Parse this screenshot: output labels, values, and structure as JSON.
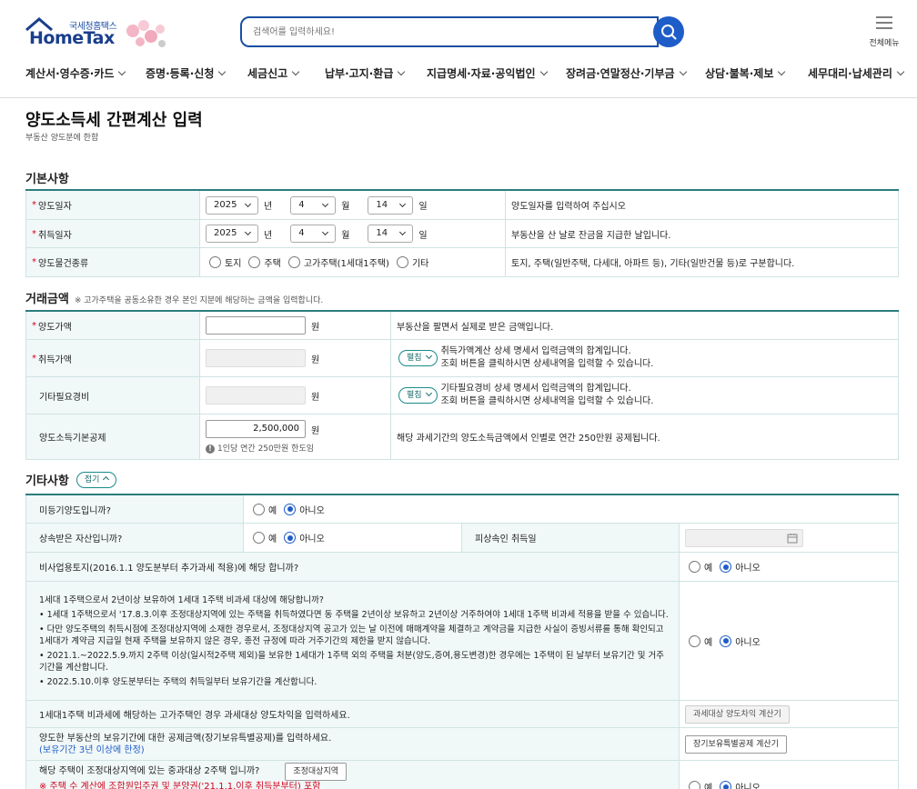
{
  "header": {
    "logo_small": "국세청홈택스",
    "logo_big": "HomeTax",
    "search_placeholder": "검색어를 입력하세요!",
    "all_menu_label": "전체메뉴"
  },
  "nav": [
    "계산서·영수증·카드",
    "증명·등록·신청",
    "세금신고",
    "납부·고지·환급",
    "지급명세·자료·공익법인",
    "장려금·연말정산·기부금",
    "상담·불복·제보",
    "세무대리·납세관리"
  ],
  "page": {
    "title": "양도소득세 간편계산 입력",
    "subtitle": "부동산 양도분에 한함"
  },
  "basic": {
    "section_title": "기본사항",
    "rows": [
      {
        "label": "양도일자",
        "year": "2025",
        "month": "4",
        "day": "14",
        "year_unit": "년",
        "month_unit": "월",
        "day_unit": "일",
        "desc": "양도일자를 입력하여 주십시오"
      },
      {
        "label": "취득일자",
        "year": "2025",
        "month": "4",
        "day": "14",
        "year_unit": "년",
        "month_unit": "월",
        "day_unit": "일",
        "desc": "부동산을 산 날로 잔금을 지급한 날입니다."
      }
    ],
    "type_row": {
      "label": "양도물건종류",
      "options": [
        "토지",
        "주택",
        "고가주택(1세대1주택)",
        "기타"
      ],
      "desc": "토지, 주택(일반주택, 다세대, 아파트 등), 기타(일반건물 등)로 구분합니다."
    }
  },
  "amount": {
    "section_title": "거래금액",
    "note": "※ 고가주택을 공동소유한 경우 본인 지분에 해당하는 금액을 입력합니다.",
    "unit": "원",
    "sale": {
      "label": "양도가액",
      "value": "",
      "desc": "부동산을 팔면서 실제로 받은 금액입니다."
    },
    "acq": {
      "label": "취득가액",
      "btn": "펼침",
      "desc1": "취득가액계산 상세 명세서 입력금액의 합계입니다.",
      "desc2": "조회 버튼을 클릭하시면 상세내역을 입력할 수 있습니다."
    },
    "exp": {
      "label": "기타필요경비",
      "btn": "펼침",
      "desc1": "기타필요경비 상세 명세서 입력금액의 합계입니다.",
      "desc2": "조회 버튼을 클릭하시면 상세내역을 입력할 수 있습니다."
    },
    "ded": {
      "label": "양도소득기본공제",
      "value": "2,500,000",
      "hint": "1인당 연간 250만원 한도임",
      "desc": "해당 과세기간의 양도소득금액에서 인별로 연간 250만원 공제됩니다."
    }
  },
  "etc": {
    "section_title": "기타사항",
    "toggle": "접기",
    "yes": "예",
    "no": "아니오",
    "q1": "미등기양도입니까?",
    "q2": "상속받은 자산입니까?",
    "q2_extra": "피상속인 취득일",
    "q3": "비사업용토지(2016.1.1 양도분부터 추가과세 적용)에 해당 합니까?",
    "q4_title": "1세대 1주택으로서 2년이상 보유하여 1세대 1주택 비과세 대상에 해당합니까?",
    "q4_notes": [
      "1세대 1주택으로서 '17.8.3.이후 조정대상지역에 있는 주택을 취득하였다면 동 주택을 2년이상 보유하고 2년이상 거주하여야 1세대 1주택 비과세 적용을 받을 수 있습니다.",
      "다만 양도주택의 취득시점에 조정대상지역에 소재한 경우로서, 조정대상지역 공고가 있는 날 이전에 매매계약을 체결하고 계약금을 지급한 사실이 증빙서류를 통해 확인되고 1세대가 계약금 지급일 현재 주택을 보유하지 않은 경우, 종전 규정에 따라 거주기간의 제한을 받지 않습니다.",
      "2021.1.~2022.5.9.까지 2주택 이상(일시적2주택 제외)을 보유한 1세대가 1주택 외의 주택을 처분(양도,증여,용도변경)한 경우에는 1주택이 된 날부터 보유기간 및 거주기간을 계산합니다.",
      "2022.5.10.이후 양도분부터는 주택의 취득일부터 보유기간을 계산합니다."
    ],
    "q5": "1세대1주택 비과세에 해당하는 고가주택인 경우 과세대상 양도차익을 입력하세요.",
    "q5_btn": "과세대상 양도차익 계산기",
    "q6": "양도한 부동산의 보유기간에 대한 공제금액(장기보유특별공제)를 입력하세요.",
    "q6_sub": "(보유기간 3년 이상에 한정)",
    "q6_btn": "장기보유특별공제 계산기",
    "q7": "해당 주택이 조정대상지역에 있는 중과대상 2주택 입니까?",
    "q7_btn": "조정대상지역",
    "q7_warn": "※ 주택 수 계산에 조합원입주권 및 분양권('21.1.1.이후 취득분부터) 포함"
  },
  "colors": {
    "accent": "#2c7d7d",
    "blue": "#1e5cc8",
    "red": "#d0021b",
    "th_bg": "#f1f8f8"
  }
}
